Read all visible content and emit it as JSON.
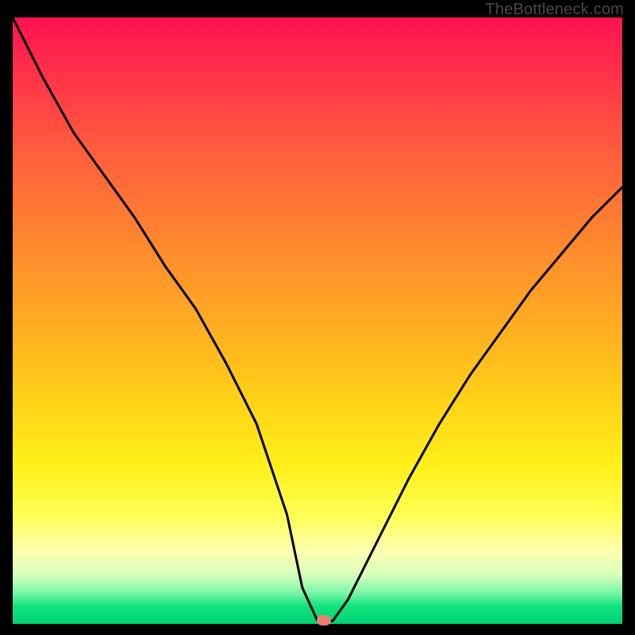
{
  "attribution": "TheBottleneck.com",
  "chart_data": {
    "type": "line",
    "title": "",
    "xlabel": "",
    "ylabel": "",
    "xlim": [
      0,
      1
    ],
    "ylim": [
      0,
      1
    ],
    "x": [
      0.0,
      0.05,
      0.1,
      0.15,
      0.2,
      0.25,
      0.3,
      0.35,
      0.4,
      0.45,
      0.475,
      0.5,
      0.525,
      0.55,
      0.6,
      0.65,
      0.7,
      0.75,
      0.8,
      0.85,
      0.9,
      0.95,
      1.0
    ],
    "values": [
      1.0,
      0.9,
      0.81,
      0.74,
      0.67,
      0.59,
      0.52,
      0.43,
      0.33,
      0.18,
      0.06,
      0.005,
      0.005,
      0.04,
      0.14,
      0.24,
      0.33,
      0.41,
      0.48,
      0.55,
      0.61,
      0.67,
      0.72
    ],
    "minimum_point": {
      "x": 0.51,
      "y": 0.005
    },
    "colors": {
      "curve": "#000000",
      "marker": "#e88074",
      "gradient_top": "#ff1351",
      "gradient_bottom": "#00d374"
    }
  }
}
